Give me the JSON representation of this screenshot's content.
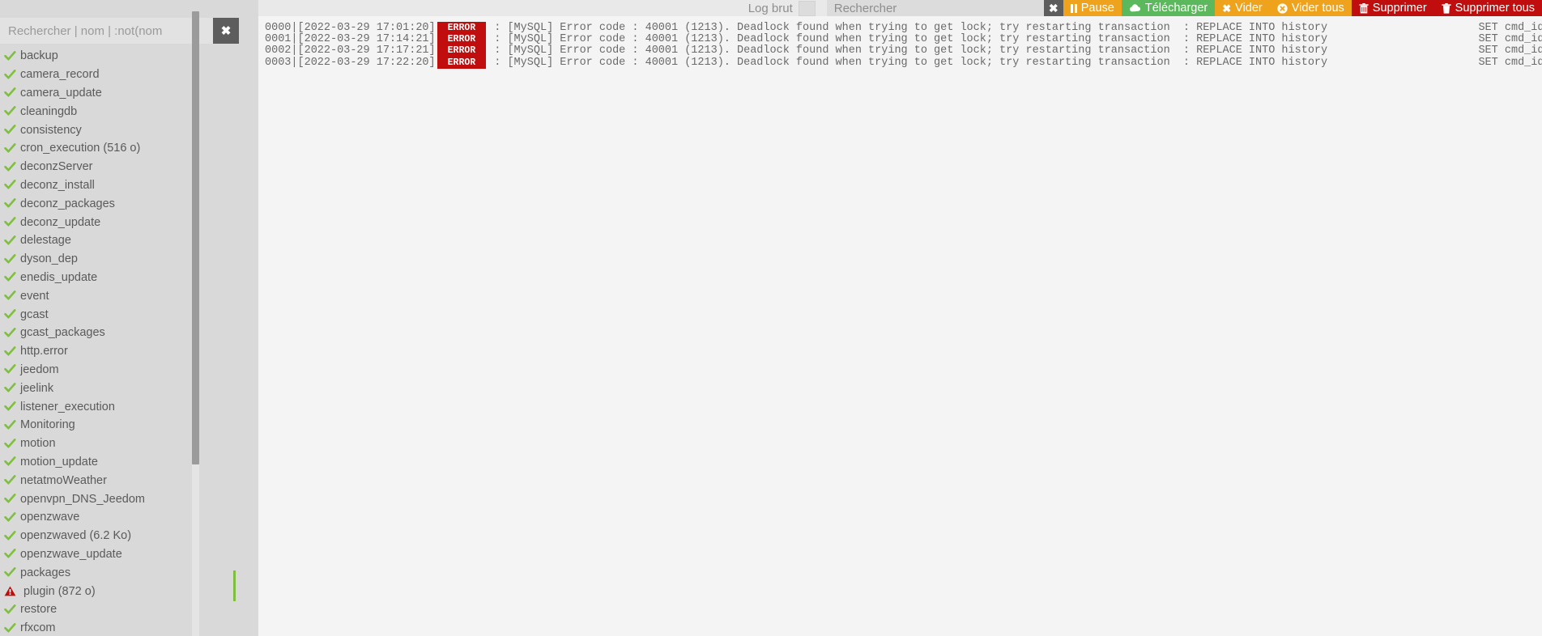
{
  "sidebar": {
    "search": {
      "placeholder": "Rechercher | nom | :not(nom",
      "value": "",
      "clear_label": "✖"
    },
    "files": [
      {
        "label": "backup",
        "status": "ok"
      },
      {
        "label": "camera_record",
        "status": "ok"
      },
      {
        "label": "camera_update",
        "status": "ok"
      },
      {
        "label": "cleaningdb",
        "status": "ok"
      },
      {
        "label": "consistency",
        "status": "ok"
      },
      {
        "label": "cron_execution (516 o)",
        "status": "ok"
      },
      {
        "label": "deconzServer",
        "status": "ok"
      },
      {
        "label": "deconz_install",
        "status": "ok"
      },
      {
        "label": "deconz_packages",
        "status": "ok"
      },
      {
        "label": "deconz_update",
        "status": "ok"
      },
      {
        "label": "delestage",
        "status": "ok"
      },
      {
        "label": "dyson_dep",
        "status": "ok"
      },
      {
        "label": "enedis_update",
        "status": "ok"
      },
      {
        "label": "event",
        "status": "ok"
      },
      {
        "label": "gcast",
        "status": "ok"
      },
      {
        "label": "gcast_packages",
        "status": "ok"
      },
      {
        "label": "http.error",
        "status": "ok"
      },
      {
        "label": "jeedom",
        "status": "ok"
      },
      {
        "label": "jeelink",
        "status": "ok"
      },
      {
        "label": "listener_execution",
        "status": "ok"
      },
      {
        "label": "Monitoring",
        "status": "ok"
      },
      {
        "label": "motion",
        "status": "ok"
      },
      {
        "label": "motion_update",
        "status": "ok"
      },
      {
        "label": "netatmoWeather",
        "status": "ok"
      },
      {
        "label": "openvpn_DNS_Jeedom",
        "status": "ok"
      },
      {
        "label": "openzwave",
        "status": "ok"
      },
      {
        "label": "openzwaved (6.2 Ko)",
        "status": "ok"
      },
      {
        "label": "openzwave_update",
        "status": "ok"
      },
      {
        "label": "packages",
        "status": "ok"
      },
      {
        "label": "plugin (872 o)",
        "status": "warn"
      },
      {
        "label": "restore",
        "status": "ok"
      },
      {
        "label": "rfxcom",
        "status": "ok"
      }
    ]
  },
  "toolbar": {
    "logbrut_label": "Log brut",
    "logbrut_checked": false,
    "search": {
      "placeholder": "Rechercher",
      "value": "",
      "clear_label": "✖"
    },
    "buttons": [
      {
        "label": "Pause",
        "icon": "pause-icon",
        "color": "#efa31d"
      },
      {
        "label": "Télécharger",
        "icon": "download-cloud-icon",
        "color": "#5cb85c"
      },
      {
        "label": "Vider",
        "icon": "times-icon",
        "color": "#efa31d"
      },
      {
        "label": "Vider tous",
        "icon": "times-circle-icon",
        "color": "#efa31d"
      },
      {
        "label": "Supprimer",
        "icon": "trash-icon",
        "color": "#c00d0d"
      },
      {
        "label": "Supprimer tous",
        "icon": "trash-alt-icon",
        "color": "#c00d0d"
      }
    ]
  },
  "log": {
    "lines": [
      {
        "index": "0000",
        "prefix": "0000|[2022-03-29 17:01:20]",
        "level": "ERROR",
        "message": " : [MySQL] Error code : 40001 (1213). Deadlock found when trying to get lock; try restarting transaction  : REPLACE INTO history                       SET cmd_id=:cmd_id,"
      },
      {
        "index": "0001",
        "prefix": "0001|[2022-03-29 17:14:21]",
        "level": "ERROR",
        "message": " : [MySQL] Error code : 40001 (1213). Deadlock found when trying to get lock; try restarting transaction  : REPLACE INTO history                       SET cmd_id=:cmd_id,"
      },
      {
        "index": "0002",
        "prefix": "0002|[2022-03-29 17:17:21]",
        "level": "ERROR",
        "message": " : [MySQL] Error code : 40001 (1213). Deadlock found when trying to get lock; try restarting transaction  : REPLACE INTO history                       SET cmd_id=:cmd_id,"
      },
      {
        "index": "0003",
        "prefix": "0003|[2022-03-29 17:22:20]",
        "level": "ERROR",
        "message": " : [MySQL] Error code : 40001 (1213). Deadlock found when trying to get lock; try restarting transaction  : REPLACE INTO history                       SET cmd_id=:cmd_id,"
      }
    ]
  },
  "colors": {
    "ok": "#7fbf3f",
    "warn": "#c00d0d",
    "error_badge": "#c00d0d",
    "orange": "#efa31d",
    "green": "#5cb85c",
    "red": "#c00d0d"
  }
}
